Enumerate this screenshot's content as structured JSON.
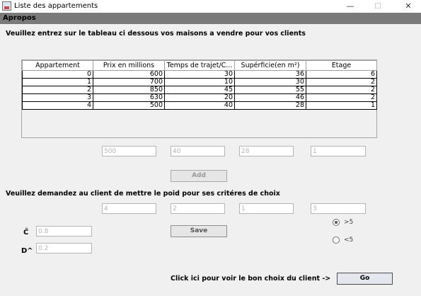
{
  "window": {
    "title": "Liste des appartements",
    "controls": {
      "minimize": "—",
      "maximize": "☐",
      "close": "✕"
    }
  },
  "menubar": {
    "items": [
      "Apropos"
    ]
  },
  "intro_text": "Veuillez entrez sur le tableau ci dessous vos maisons a vendre pour vos clients",
  "table": {
    "columns": [
      "Appartement",
      "Prix en millions",
      "Temps de trajet/C...",
      "Supérficie(en m²)",
      "Etage"
    ],
    "rows": [
      [
        "0",
        "600",
        "30",
        "36",
        "6"
      ],
      [
        "1",
        "700",
        "10",
        "30",
        "2"
      ],
      [
        "2",
        "850",
        "45",
        "55",
        "2"
      ],
      [
        "3",
        "630",
        "20",
        "46",
        "2"
      ],
      [
        "4",
        "500",
        "40",
        "28",
        "1"
      ]
    ]
  },
  "add_form": {
    "fields": [
      "500",
      "40",
      "28",
      "1"
    ],
    "add_button": "Add"
  },
  "weights_text": "Veuillez demandez au client de mettre le poid pour ses critéres de choix",
  "weights": {
    "fields": [
      "4",
      "2",
      "1",
      "3"
    ]
  },
  "params": {
    "c_label": "Ĉ",
    "c_value": "0.8",
    "d_label": "D^",
    "d_value": "0.2"
  },
  "save_button": "Save",
  "radios": [
    {
      "label": ">5",
      "selected": true
    },
    {
      "label": "<5",
      "selected": false
    }
  ],
  "bottom": {
    "prompt": "Click ici pour voir le bon choix du client ->",
    "go_button": "Go"
  }
}
